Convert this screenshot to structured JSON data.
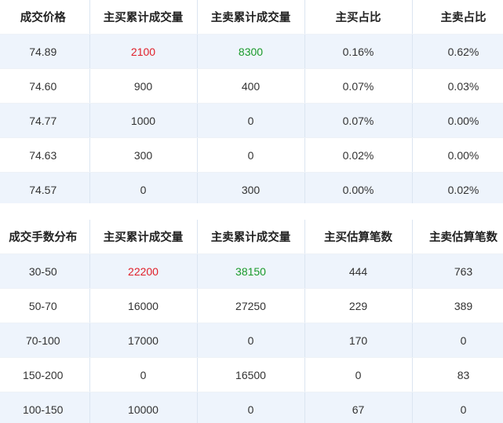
{
  "price_table": {
    "headers": [
      "成交价格",
      "主买累计成交量",
      "主卖累计成交量",
      "主买占比",
      "主卖占比"
    ],
    "rows": [
      [
        "74.89",
        "2100",
        "8300",
        "0.16%",
        "0.62%"
      ],
      [
        "74.60",
        "900",
        "400",
        "0.07%",
        "0.03%"
      ],
      [
        "74.77",
        "1000",
        "0",
        "0.07%",
        "0.00%"
      ],
      [
        "74.63",
        "300",
        "0",
        "0.02%",
        "0.00%"
      ],
      [
        "74.57",
        "0",
        "300",
        "0.00%",
        "0.02%"
      ]
    ]
  },
  "distribution_table": {
    "headers": [
      "成交手数分布",
      "主买累计成交量",
      "主卖累计成交量",
      "主买估算笔数",
      "主卖估算笔数"
    ],
    "rows": [
      [
        "30-50",
        "22200",
        "38150",
        "444",
        "763"
      ],
      [
        "50-70",
        "16000",
        "27250",
        "229",
        "389"
      ],
      [
        "70-100",
        "17000",
        "0",
        "170",
        "0"
      ],
      [
        "150-200",
        "0",
        "16500",
        "0",
        "83"
      ],
      [
        "100-150",
        "10000",
        "0",
        "67",
        "0"
      ]
    ]
  },
  "colors": {
    "buy_highlight": "#e0202a",
    "sell_highlight": "#1a9a2a",
    "stripe": "#eef4fc"
  }
}
